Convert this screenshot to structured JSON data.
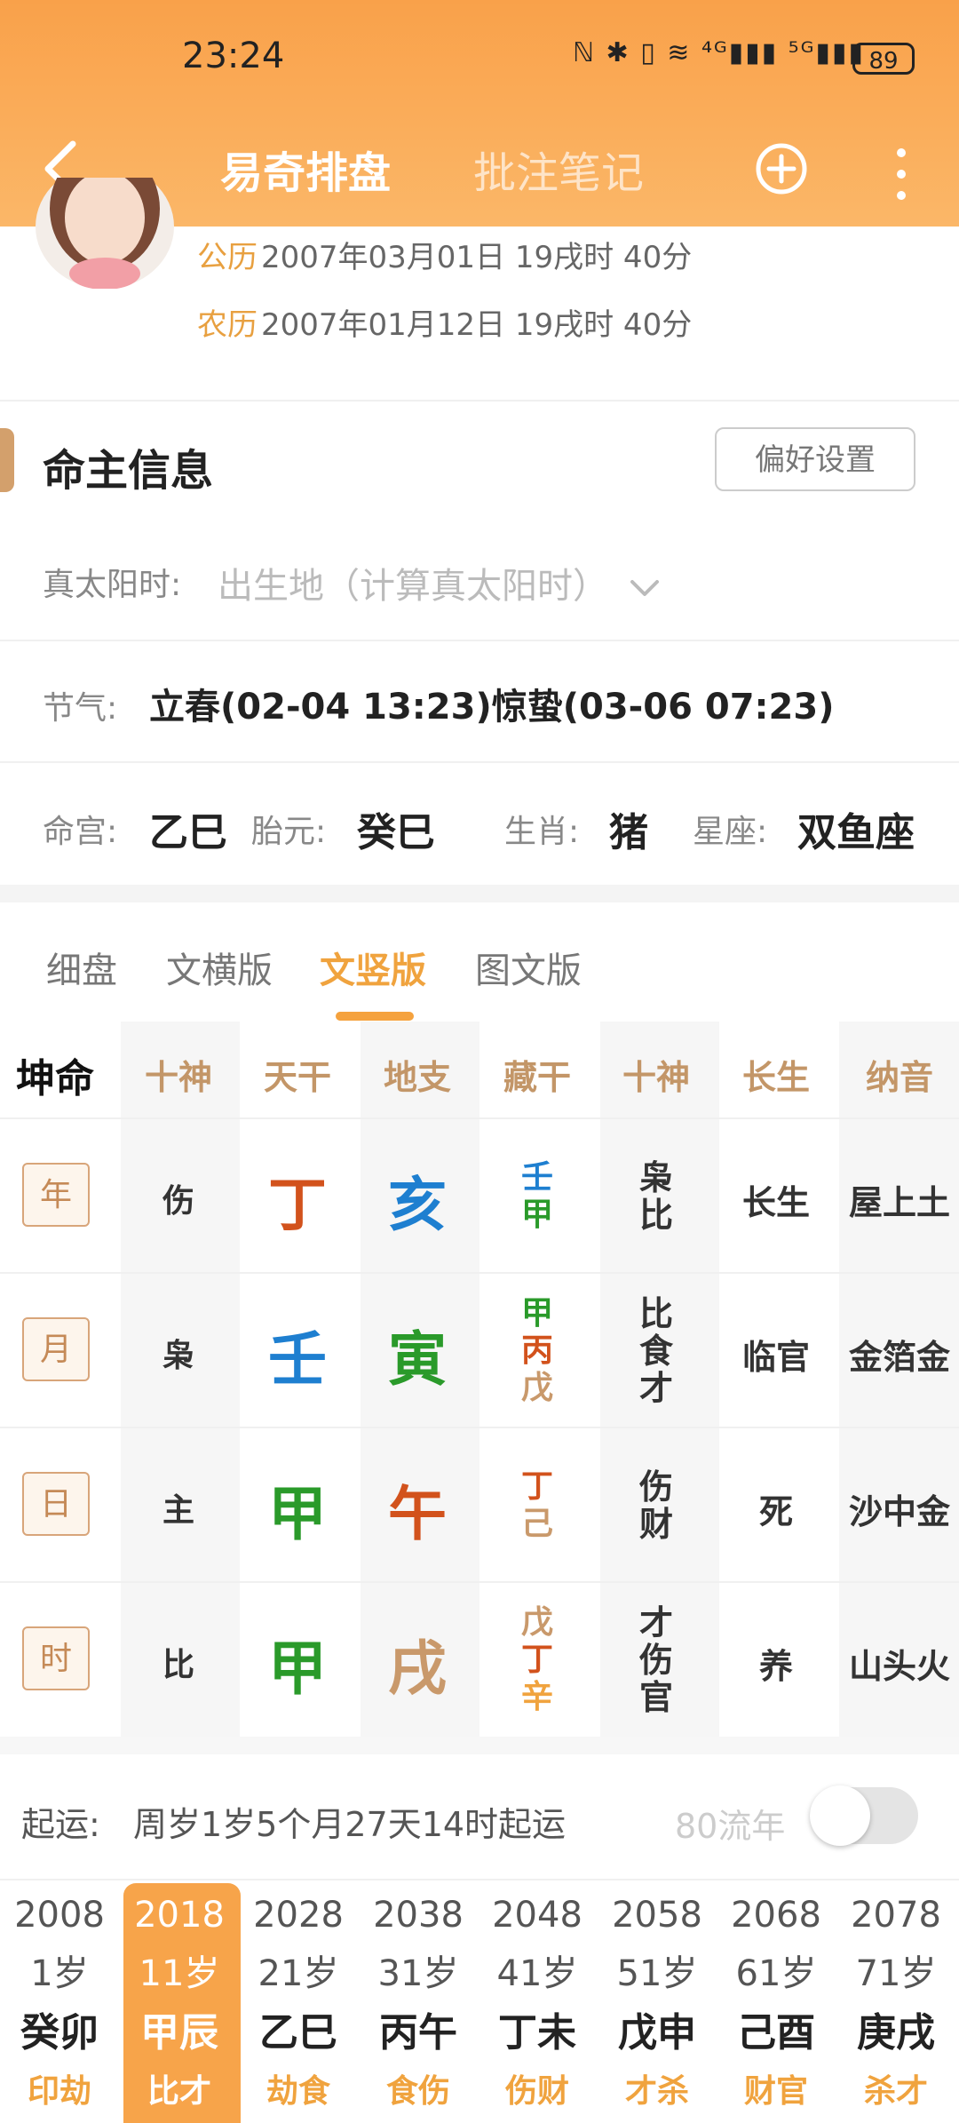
{
  "status_bar": {
    "time": "23:24",
    "icons": "ℕ ✱ ▯ ≋ ⁴ᴳ▮▮▮ ⁵ᴳ▮▮▮",
    "battery": "89"
  },
  "nav": {
    "title": "易奇排盘",
    "notes": "批注笔记"
  },
  "birth": {
    "solar_label": "公历",
    "solar_value": "2007年03月01日 19戌时 40分",
    "lunar_label": "农历",
    "lunar_value": "2007年01月12日 19戌时 40分"
  },
  "info": {
    "title": "命主信息",
    "pref_button": "偏好设置",
    "solar_time_label": "真太阳时:",
    "solar_time_value": "出生地（计算真太阳时）",
    "jieqi_label": "节气:",
    "jieqi_value": "立春(02-04 13:23)惊蛰(03-06 07:23)",
    "minggong_label": "命宫:",
    "minggong_value": "乙巳",
    "taiyuan_label": "胎元:",
    "taiyuan_value": "癸巳",
    "shengxiao_label": "生肖:",
    "shengxiao_value": "猪",
    "xingzuo_label": "星座:",
    "xingzuo_value": "双鱼座"
  },
  "tabs": [
    "细盘",
    "文横版",
    "文竖版",
    "图文版"
  ],
  "tabs_active_index": 2,
  "grid": {
    "corner": "坤命",
    "headers": [
      "十神",
      "天干",
      "地支",
      "藏干",
      "十神",
      "长生",
      "纳音"
    ],
    "rows": [
      {
        "pillar": "年",
        "shishen": "伤",
        "gan": "丁",
        "zhi": "亥",
        "canggan": [
          "壬",
          "甲"
        ],
        "canggan_colors": [
          "#1e7fd0",
          "#2a9a2a"
        ],
        "shishen2": [
          "枭",
          "比"
        ],
        "changsheng": "长生",
        "nayin": "屋上土",
        "gan_color": "#d2521c",
        "zhi_color": "#1e7fd0"
      },
      {
        "pillar": "月",
        "shishen": "枭",
        "gan": "壬",
        "zhi": "寅",
        "canggan": [
          "甲",
          "丙",
          "戊"
        ],
        "canggan_colors": [
          "#2a9a2a",
          "#d2521c",
          "#c9996b"
        ],
        "shishen2": [
          "比",
          "食",
          "才"
        ],
        "changsheng": "临官",
        "nayin": "金箔金",
        "gan_color": "#1e7fd0",
        "zhi_color": "#2a9a2a"
      },
      {
        "pillar": "日",
        "shishen": "主",
        "gan": "甲",
        "zhi": "午",
        "canggan": [
          "丁",
          "己"
        ],
        "canggan_colors": [
          "#d2521c",
          "#c9996b"
        ],
        "shishen2": [
          "伤",
          "财"
        ],
        "changsheng": "死",
        "nayin": "沙中金",
        "gan_color": "#2a9a2a",
        "zhi_color": "#d2521c"
      },
      {
        "pillar": "时",
        "shishen": "比",
        "gan": "甲",
        "zhi": "戌",
        "canggan": [
          "戊",
          "丁",
          "辛"
        ],
        "canggan_colors": [
          "#c9996b",
          "#d2521c",
          "#f0a33e"
        ],
        "shishen2": [
          "才",
          "伤",
          "官"
        ],
        "changsheng": "养",
        "nayin": "山头火",
        "gan_color": "#2a9a2a",
        "zhi_color": "#c9996b"
      }
    ]
  },
  "qiyun": {
    "label": "起运:",
    "text": "周岁1岁5个月27天14时起运",
    "liunian_label": "80流年"
  },
  "dayun": {
    "selected_index": 1,
    "items": [
      {
        "year": "2008",
        "age": "1岁",
        "gz": "癸卯",
        "ss": "印劫"
      },
      {
        "year": "2018",
        "age": "11岁",
        "gz": "甲辰",
        "ss": "比才"
      },
      {
        "year": "2028",
        "age": "21岁",
        "gz": "乙巳",
        "ss": "劫食"
      },
      {
        "year": "2038",
        "age": "31岁",
        "gz": "丙午",
        "ss": "食伤"
      },
      {
        "year": "2048",
        "age": "41岁",
        "gz": "丁未",
        "ss": "伤财"
      },
      {
        "year": "2058",
        "age": "51岁",
        "gz": "戊申",
        "ss": "才杀"
      },
      {
        "year": "2068",
        "age": "61岁",
        "gz": "己酉",
        "ss": "财官"
      },
      {
        "year": "2078",
        "age": "71岁",
        "gz": "庚戌",
        "ss": "杀才"
      }
    ]
  },
  "colors": {
    "brand": "#f7a44a",
    "accent_text": "#f0a33e",
    "header_text": "#c39668"
  }
}
